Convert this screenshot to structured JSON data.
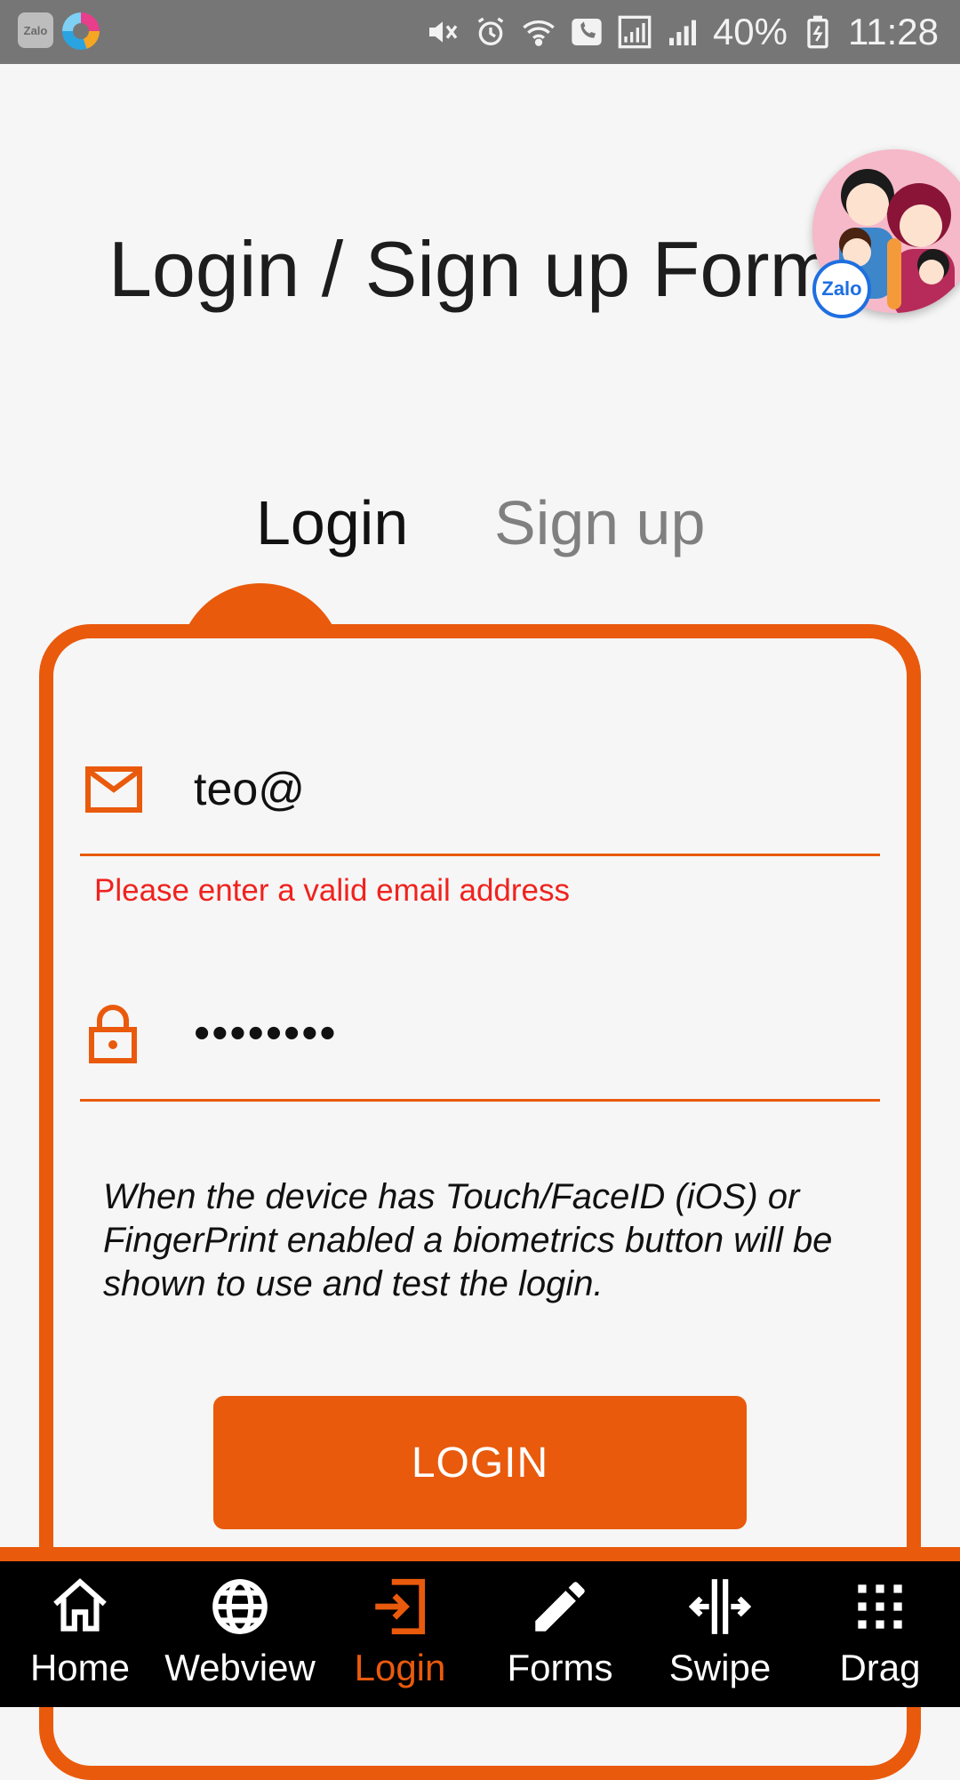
{
  "status_bar": {
    "battery": "40%",
    "time": "11:28",
    "left_icons": [
      "zalo-icon",
      "app-ball-icon"
    ],
    "right_icons": [
      "mute-icon",
      "alarm-icon",
      "wifi-icon",
      "call-icon",
      "signal-icon",
      "signal-icon",
      "battery-icon"
    ]
  },
  "page": {
    "title": "Login / Sign up Form"
  },
  "chat_head": {
    "badge": "Zalo"
  },
  "tabs": [
    {
      "label": "Login",
      "active": true
    },
    {
      "label": "Sign up",
      "active": false
    }
  ],
  "form": {
    "email": {
      "value": "teo@",
      "icon": "mail-icon"
    },
    "email_error": "Please enter a valid email address",
    "password": {
      "value": "••••••••",
      "icon": "lock-icon"
    },
    "hint": "When the device has Touch/FaceID (iOS) or FingerPrint enabled a biometrics button will be shown to use and test the login.",
    "submit_label": "LOGIN"
  },
  "bottom_nav": [
    {
      "label": "Home",
      "icon": "home-icon",
      "active": false
    },
    {
      "label": "Webview",
      "icon": "globe-icon",
      "active": false
    },
    {
      "label": "Login",
      "icon": "login-icon",
      "active": true
    },
    {
      "label": "Forms",
      "icon": "pencil-icon",
      "active": false
    },
    {
      "label": "Swipe",
      "icon": "swipe-icon",
      "active": false
    },
    {
      "label": "Drag",
      "icon": "grid-icon",
      "active": false
    }
  ],
  "colors": {
    "accent": "#e95a0c",
    "error": "#f0221e",
    "status_bar": "#767676",
    "nav_background": "#000000"
  }
}
